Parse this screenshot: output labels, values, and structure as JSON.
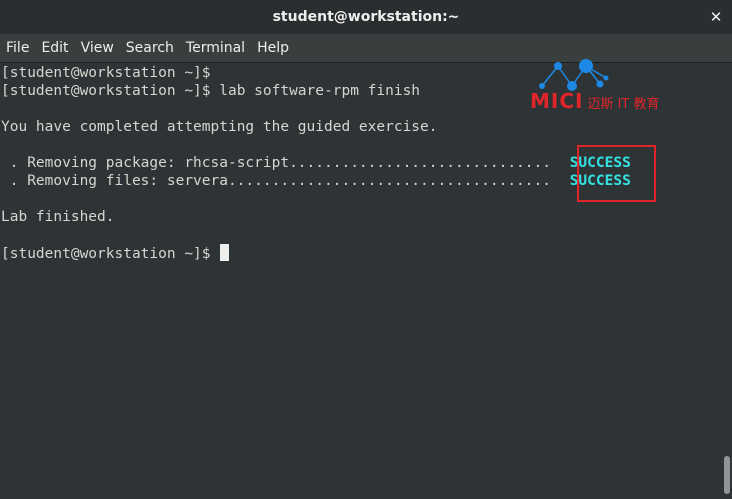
{
  "window": {
    "title": "student@workstation:~",
    "close_glyph": "✕"
  },
  "menu": {
    "items": [
      "File",
      "Edit",
      "View",
      "Search",
      "Terminal",
      "Help"
    ]
  },
  "terminal": {
    "lines": [
      "[student@workstation ~]$",
      "[student@workstation ~]$ lab software-rpm finish",
      "",
      "You have completed attempting the guided exercise.",
      "",
      " . Removing package: rhcsa-script.............................. ",
      " . Removing files: servera..................................... ",
      "",
      "Lab finished.",
      "",
      "[student@workstation ~]$ "
    ],
    "status_1": "SUCCESS",
    "status_2": "SUCCESS"
  },
  "logo": {
    "brand": "MICI",
    "subtitle": "迈斯 IT 教育"
  },
  "colors": {
    "terminal_bg": "#2e3436",
    "terminal_fg": "#d3d7cf",
    "success": "#34e2e2",
    "annotation_red": "#e0252a",
    "logo_blue": "#1e88e5"
  },
  "icons": {
    "close": "close-icon",
    "logo_network": "network-nodes-icon"
  }
}
